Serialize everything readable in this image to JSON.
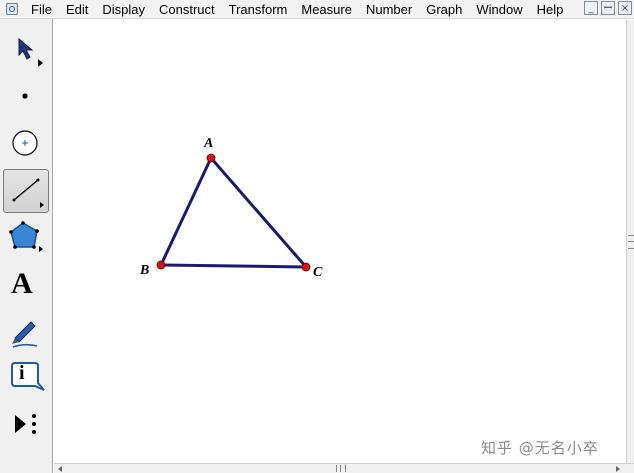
{
  "menubar": {
    "items": [
      "File",
      "Edit",
      "Display",
      "Construct",
      "Transform",
      "Measure",
      "Number",
      "Graph",
      "Window",
      "Help"
    ],
    "window_buttons": [
      "_",
      "ꟷ",
      "×"
    ]
  },
  "toolbox": {
    "tools": [
      {
        "name": "arrow-select-tool",
        "selected": false
      },
      {
        "name": "point-tool",
        "selected": false
      },
      {
        "name": "compass-circle-tool",
        "selected": false
      },
      {
        "name": "straightedge-segment-tool",
        "selected": true
      },
      {
        "name": "polygon-tool",
        "selected": false
      },
      {
        "name": "text-tool",
        "selected": false,
        "glyph": "A"
      },
      {
        "name": "marker-tool",
        "selected": false
      },
      {
        "name": "information-tool",
        "selected": false,
        "glyph": "i"
      },
      {
        "name": "custom-tool",
        "selected": false
      }
    ]
  },
  "canvas": {
    "points": [
      {
        "label": "A"
      },
      {
        "label": "B"
      },
      {
        "label": "C"
      }
    ],
    "segment_color": "#1a1a6e",
    "point_color": "#d41414"
  },
  "watermark": "知乎 @无名小卒"
}
